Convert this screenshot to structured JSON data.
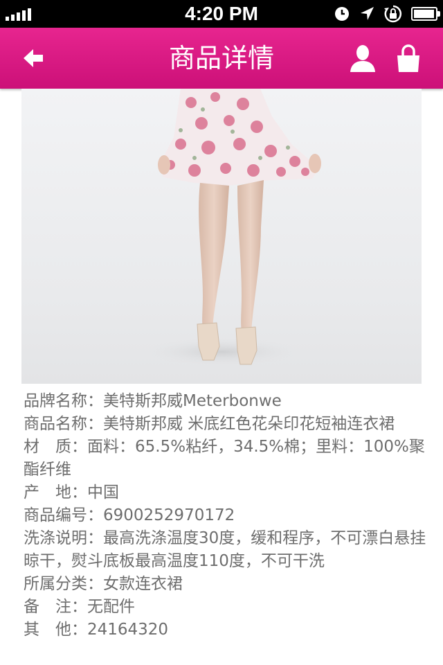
{
  "status_bar": {
    "time": "4:20 PM"
  },
  "nav": {
    "title": "商品详情"
  },
  "product": {
    "details": [
      {
        "label": "品牌名称：",
        "value": "美特斯邦威Meterbonwe"
      },
      {
        "label": "商品名称：",
        "value": "美特斯邦威 米底红色花朵印花短袖连衣裙"
      },
      {
        "label": "材　质：",
        "value": "面料：65.5%粘纤，34.5%棉；里料：100%聚酯纤维"
      },
      {
        "label": "产　地：",
        "value": "中国"
      },
      {
        "label": "商品编号：",
        "value": "6900252970172"
      },
      {
        "label": "洗涤说明：",
        "value": "最高洗涤温度30度，缓和程序，不可漂白悬挂晾干，熨斗底板最高温度110度，不可干洗"
      },
      {
        "label": "所属分类：",
        "value": "女款连衣裙"
      },
      {
        "label": "备　注：",
        "value": "无配件"
      },
      {
        "label": "其　他：",
        "value": "24164320"
      }
    ]
  },
  "colors": {
    "nav_bar": "#d81b82",
    "detail_text": "#6d6d6d"
  },
  "icons": {
    "back": "back-arrow-icon",
    "user": "user-icon",
    "bag": "shopping-bag-icon"
  }
}
